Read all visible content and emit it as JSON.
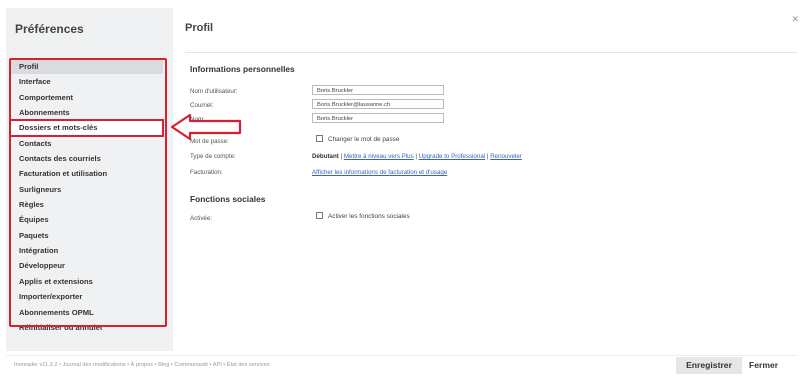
{
  "sidebar": {
    "title": "Préférences",
    "items": [
      {
        "label": "Profil"
      },
      {
        "label": "Interface"
      },
      {
        "label": "Comportement"
      },
      {
        "label": "Abonnements"
      },
      {
        "label": "Dossiers et mots-clés"
      },
      {
        "label": "Contacts"
      },
      {
        "label": "Contacts des courriels"
      },
      {
        "label": "Facturation et utilisation"
      },
      {
        "label": "Surligneurs"
      },
      {
        "label": "Règles"
      },
      {
        "label": "Équipes"
      },
      {
        "label": "Paquets"
      },
      {
        "label": "Intégration"
      },
      {
        "label": "Développeur"
      },
      {
        "label": "Applis et extensions"
      },
      {
        "label": "Importer/exporter"
      },
      {
        "label": "Abonnements OPML"
      },
      {
        "label": "Réinitialiser ou annuler"
      }
    ]
  },
  "main": {
    "title": "Profil",
    "personal": {
      "title": "Informations personnelles",
      "username_label": "Nom d'utilisateur:",
      "username_value": "Boris.Bruckler",
      "email_label": "Courriel:",
      "email_value": "Boris.Bruckler@lausanne.ch",
      "name_label": "Nom:",
      "name_value": "Boris.Bruckler",
      "password_label": "Mot de passe:",
      "change_password_label": "Changer le mot de passe",
      "account_type_label": "Type de compte:",
      "account_type_value": "Débutant",
      "upgrade_plus": "Mettre à niveau vers Plus",
      "upgrade_pro": "Upgrade to Professional",
      "renew": "Renouveler",
      "billing_label": "Facturation:",
      "billing_link": "Afficher les informations de facturation et d'usage"
    },
    "social": {
      "title": "Fonctions sociales",
      "enabled_label": "Activée:",
      "enable_checkbox_label": "Activer les fonctions sociales"
    }
  },
  "footer": {
    "text": "Inoreader v11.3.2 • Journal des modifications • À propos • Blog • Communauté • API • État des services",
    "save": "Enregistrer",
    "close": "Fermer"
  },
  "colors": {
    "highlight": "#d82030",
    "link": "#3a63b8"
  }
}
